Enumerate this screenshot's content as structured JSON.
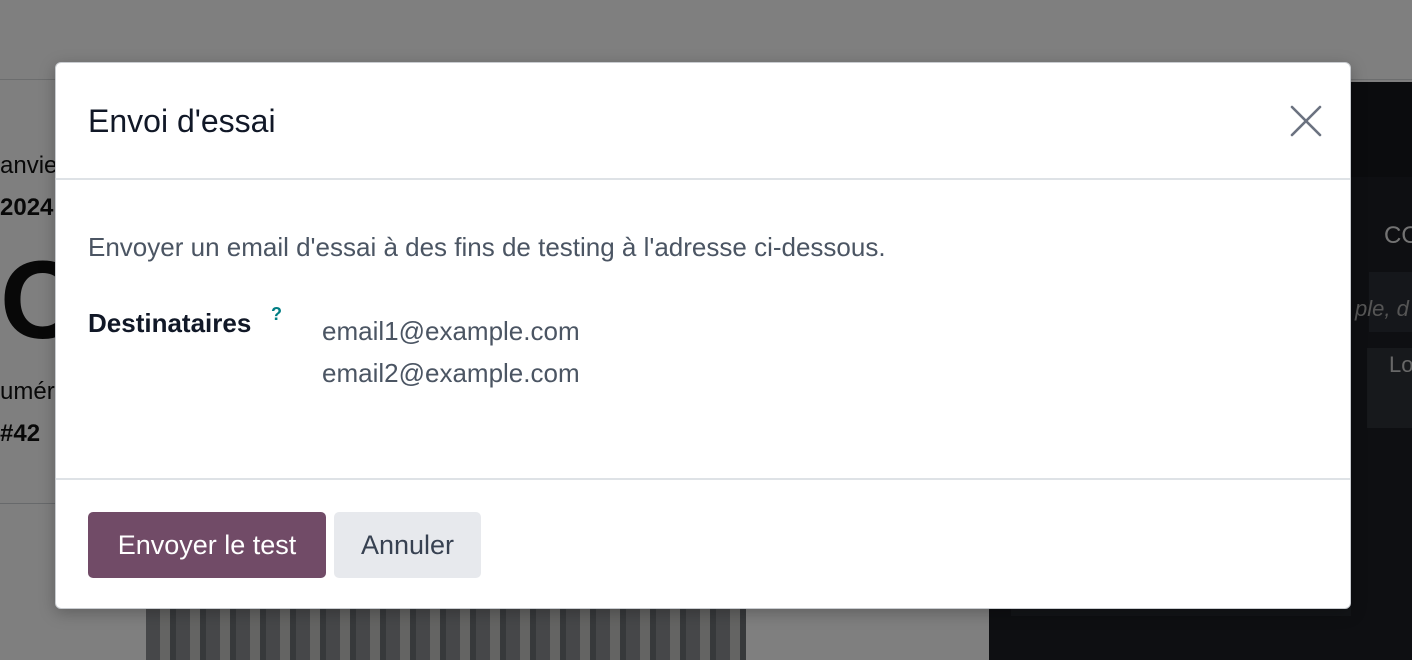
{
  "background": {
    "date_label": "anvie",
    "date_value": "2024",
    "big_text": "OT",
    "number_label": "umér",
    "number_value": "#42",
    "right_tab": "CO",
    "right_search": "ple, d",
    "right_column": "Lo"
  },
  "dialog": {
    "title": "Envoi d'essai",
    "close_icon": "close-icon",
    "intro": "Envoyer un email d'essai à des fins de testing à l'adresse ci-dessous.",
    "recipients_label": "Destinataires",
    "help_mark": "?",
    "recipients": [
      "email1@example.com",
      "email2@example.com"
    ],
    "send_button": "Envoyer le test",
    "cancel_button": "Annuler"
  },
  "colors": {
    "primary": "#714b67",
    "secondary_button": "#e7e9ed",
    "help": "#017e84"
  }
}
